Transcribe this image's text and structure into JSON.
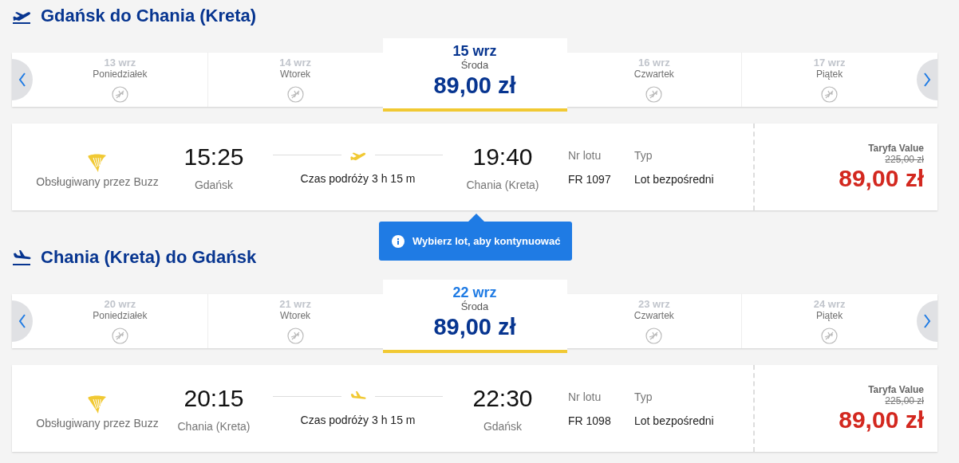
{
  "sections": [
    {
      "kind": "outbound",
      "title": "Gdańsk do Chania (Kreta)",
      "focused": true,
      "dates": [
        {
          "date": "13 wrz",
          "day": "Poniedziałek",
          "selected": false
        },
        {
          "date": "14 wrz",
          "day": "Wtorek",
          "selected": false
        },
        {
          "date": "15 wrz",
          "day": "Środa",
          "price": "89,00 zł",
          "selected": true
        },
        {
          "date": "16 wrz",
          "day": "Czwartek",
          "selected": false
        },
        {
          "date": "17 wrz",
          "day": "Piątek",
          "selected": false
        }
      ],
      "flight": {
        "operator": "Obsługiwany przez Buzz",
        "departure_time": "15:25",
        "departure_city": "Gdańsk",
        "duration": "Czas podróży 3 h 15 m",
        "arrival_time": "19:40",
        "arrival_city": "Chania (Kreta)",
        "flight_no_label": "Nr lotu",
        "flight_no": "FR 1097",
        "type_label": "Typ",
        "type": "Lot bezpośredni",
        "fare_name": "Taryfa Value",
        "old_price": "225,00 zł",
        "price": "89,00 zł"
      }
    },
    {
      "kind": "inbound",
      "title": "Chania (Kreta) do Gdańsk",
      "focused": false,
      "dates": [
        {
          "date": "20 wrz",
          "day": "Poniedziałek",
          "selected": false
        },
        {
          "date": "21 wrz",
          "day": "Wtorek",
          "selected": false
        },
        {
          "date": "22 wrz",
          "day": "Środa",
          "price": "89,00 zł",
          "selected": true
        },
        {
          "date": "23 wrz",
          "day": "Czwartek",
          "selected": false
        },
        {
          "date": "24 wrz",
          "day": "Piątek",
          "selected": false
        }
      ],
      "flight": {
        "operator": "Obsługiwany przez Buzz",
        "departure_time": "20:15",
        "departure_city": "Chania (Kreta)",
        "duration": "Czas podróży 3 h 15 m",
        "arrival_time": "22:30",
        "arrival_city": "Gdańsk",
        "flight_no_label": "Nr lotu",
        "flight_no": "FR 1098",
        "type_label": "Typ",
        "type": "Lot bezpośredni",
        "fare_name": "Taryfa Value",
        "old_price": "225,00 zł",
        "price": "89,00 zł"
      }
    }
  ],
  "tooltip": {
    "text": "Wybierz lot, aby kontynuować"
  }
}
